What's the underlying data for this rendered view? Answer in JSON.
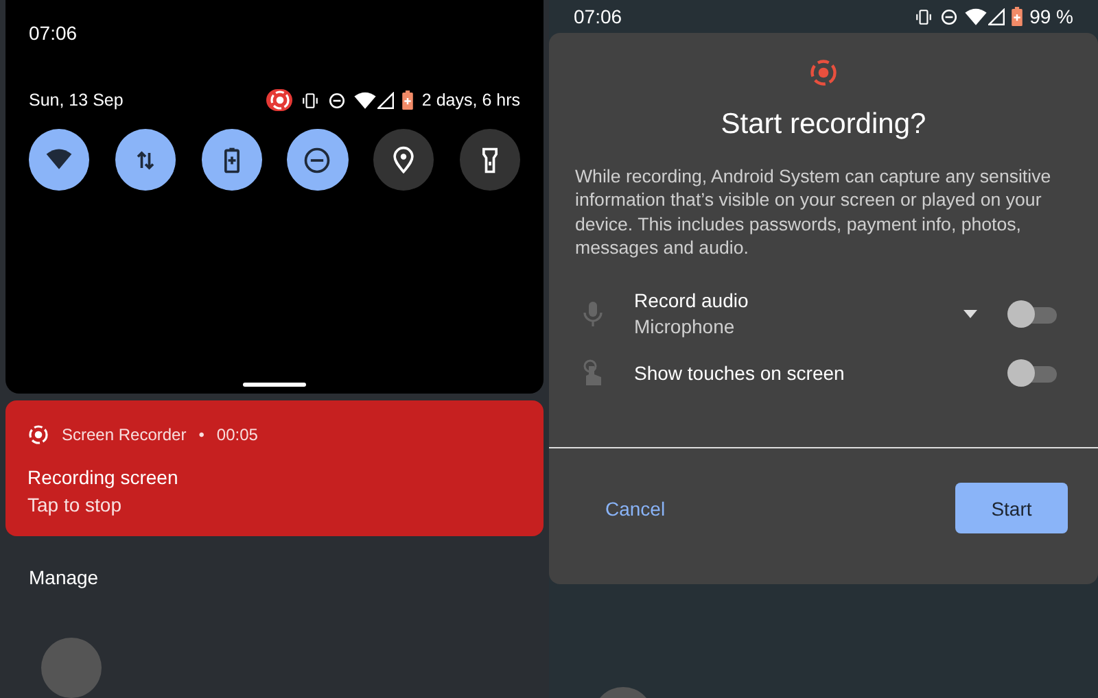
{
  "shade": {
    "time": "07:06",
    "date": "Sun, 13 Sep",
    "battery_estimate": "2 days, 6 hrs",
    "tiles": [
      {
        "on": true
      },
      {
        "on": true
      },
      {
        "on": true
      },
      {
        "on": true
      },
      {
        "on": false
      },
      {
        "on": false
      }
    ]
  },
  "notification": {
    "app": "Screen Recorder",
    "separator": "•",
    "elapsed": "00:05",
    "title": "Recording screen",
    "text": "Tap to stop"
  },
  "manage": "Manage",
  "status_bar": {
    "time": "07:06",
    "battery": "99 %"
  },
  "dialog": {
    "title": "Start recording?",
    "message": "While recording, Android System can capture any sensitive information that’s visible on your screen or played on your device. This includes passwords, payment info, photos, messages and audio.",
    "options": [
      {
        "kind": "dropdown",
        "label": "Record audio",
        "value": "Microphone",
        "on": false
      },
      {
        "kind": "plain",
        "label": "Show touches on screen",
        "on": false
      }
    ],
    "buttons": [
      {
        "kind": "text",
        "label": "Cancel"
      },
      {
        "kind": "filled",
        "label": "Start"
      }
    ]
  }
}
